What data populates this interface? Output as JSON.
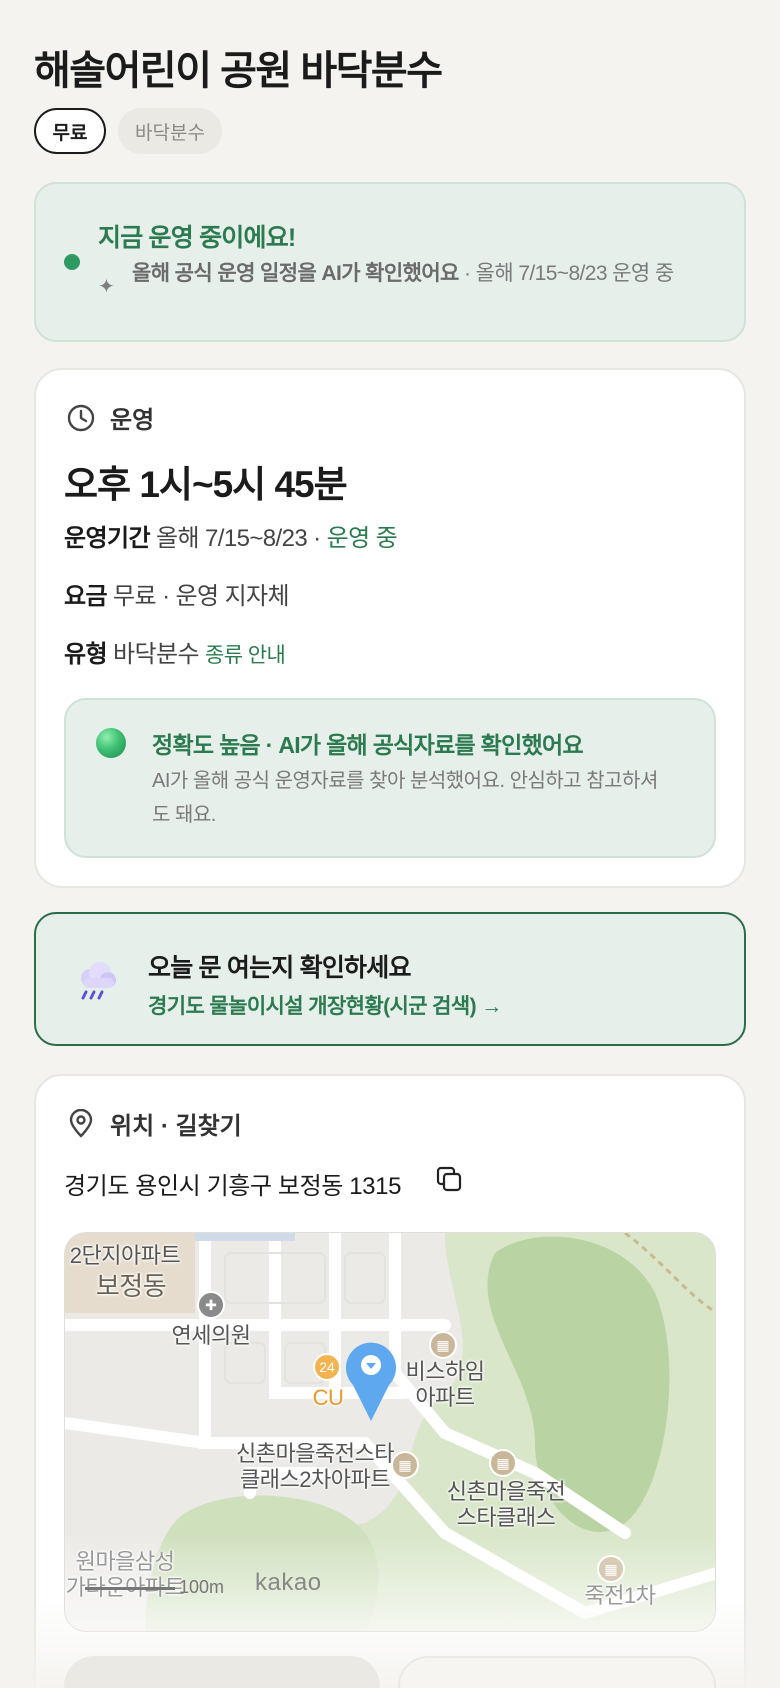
{
  "header": {
    "title": "해솔어린이 공원 바닥분수",
    "chips": [
      "무료",
      "바닥분수"
    ]
  },
  "status": {
    "title": "지금 운영 중이에요!",
    "desc_bold": "올해 공식 운영 일정을 AI가 확인했어요",
    "desc_rest": " · 올해 7/15~8/23 운영 중",
    "colors": {
      "accent": "#2b7a50",
      "dot": "#2e9a62",
      "background": "#e6efea"
    }
  },
  "operation": {
    "section_label": "운영",
    "hours": "오후 1시~5시 45분",
    "period_label": "운영기간",
    "period_value": "올해 7/15~8/23 · ",
    "period_status": "운영 중",
    "fee_label": "요금",
    "fee_value": "무료 · 운영 지자체",
    "type_label": "유형",
    "type_value": "바닥분수",
    "type_link": "종류 안내",
    "accuracy_title": "정확도 높음 · AI가 올해 공식자료를 확인했어요",
    "accuracy_desc": "AI가 올해 공식 운영자료를 찾아 분석했어요. 안심하고 참고하셔도 돼요."
  },
  "cta": {
    "icon": "rain-cloud-icon",
    "title": "오늘 문 여는지 확인하세요",
    "link": "경기도 물놀이시설 개장현황(시군 검색) →"
  },
  "location": {
    "section_label": "위치 · 길찾기",
    "address": "경기도 용인시 기흥구 보정동 1315",
    "map": {
      "labels": {
        "apt_top_1": "2단지아파트",
        "bojeong": "보정동",
        "clinic": "연세의원",
        "cu": "CU",
        "bis_line1": "비스하임",
        "bis_line2": "아파트",
        "star2_line1": "신촌마을죽전스타",
        "star2_line2": "클래스2차아파트",
        "star_line1": "신촌마을죽전",
        "star_line2": "스타클래스",
        "samsung_line1": "원마을삼성",
        "samsung_line2": "가타운아파트",
        "jukjeon": "죽전1차",
        "scale": "100m",
        "brand": "kakao"
      }
    }
  }
}
